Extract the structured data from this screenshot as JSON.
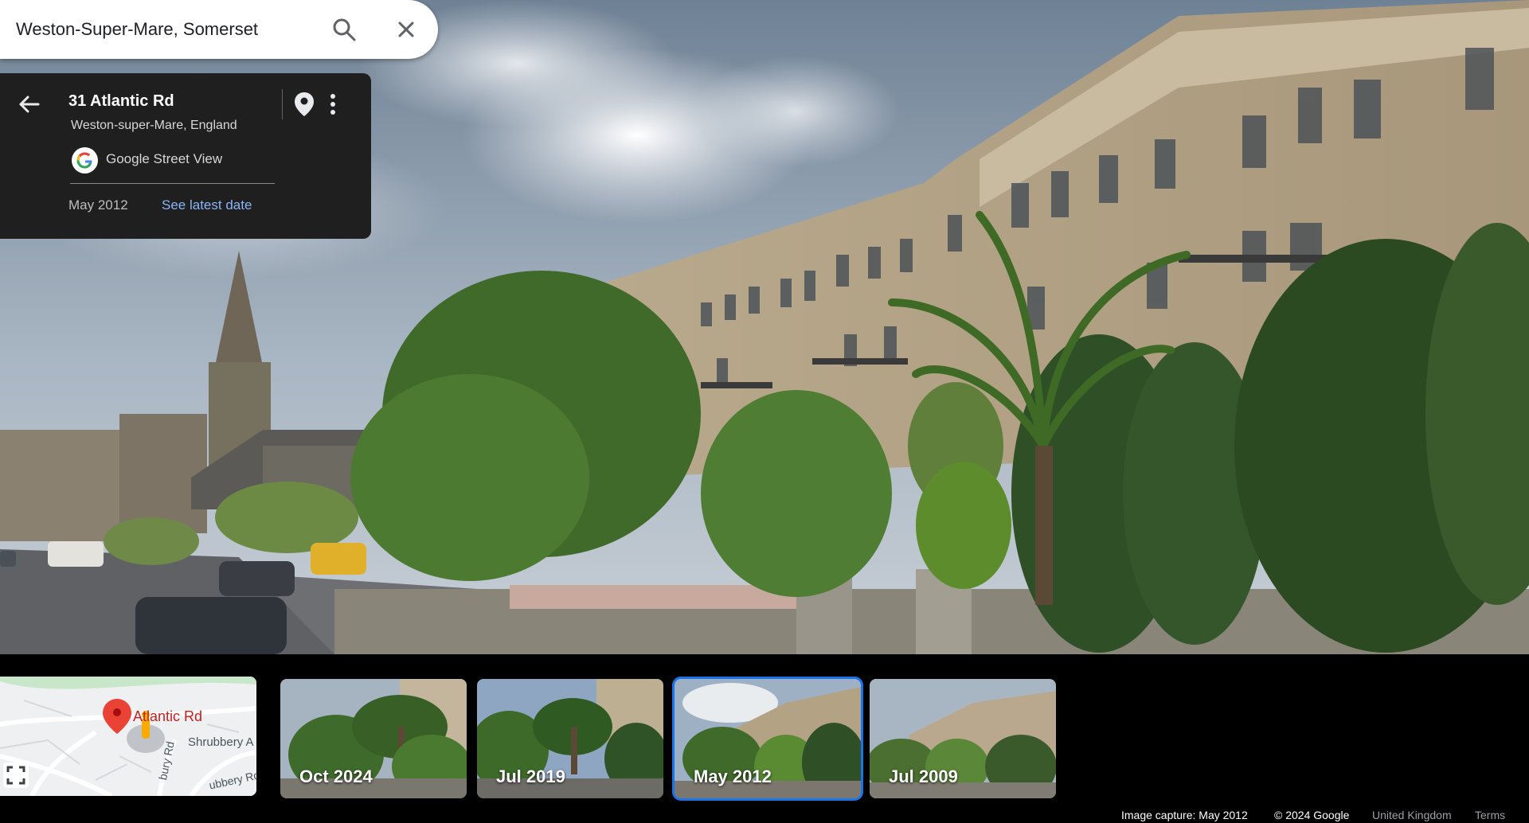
{
  "search": {
    "value": "Weston-Super-Mare, Somerset",
    "placeholder": "Search Google Maps"
  },
  "icons": {
    "search": "search-icon",
    "close": "close-icon",
    "back": "arrow-back-icon",
    "pin": "map-pin-icon",
    "more": "more-vert-icon",
    "google": "google-logo",
    "fullscreen": "fullscreen-icon",
    "map_marker": "red-map-marker"
  },
  "card": {
    "title": "31 Atlantic Rd",
    "subtitle": "Weston-super-Mare, England",
    "source": "Google Street View",
    "date": "May 2012",
    "latest_link": "See latest date"
  },
  "minimap": {
    "street_1": "Atlantic Rd",
    "street_2": "Shrubbery A",
    "street_3": "bury Rd",
    "street_4": "ubbery Rd"
  },
  "timeline": [
    {
      "label": "Oct 2024",
      "selected": false
    },
    {
      "label": "Jul 2019",
      "selected": false
    },
    {
      "label": "May 2012",
      "selected": true
    },
    {
      "label": "Jul 2009",
      "selected": false
    }
  ],
  "footer": {
    "capture": "Image capture: May 2012",
    "copyright": "© 2024 Google",
    "region": "United Kingdom",
    "terms": "Terms"
  },
  "colors": {
    "accent": "#1a73e8",
    "link": "#8ab4f8",
    "card_bg": "#1f1f1f",
    "marker": "#ea4335"
  }
}
